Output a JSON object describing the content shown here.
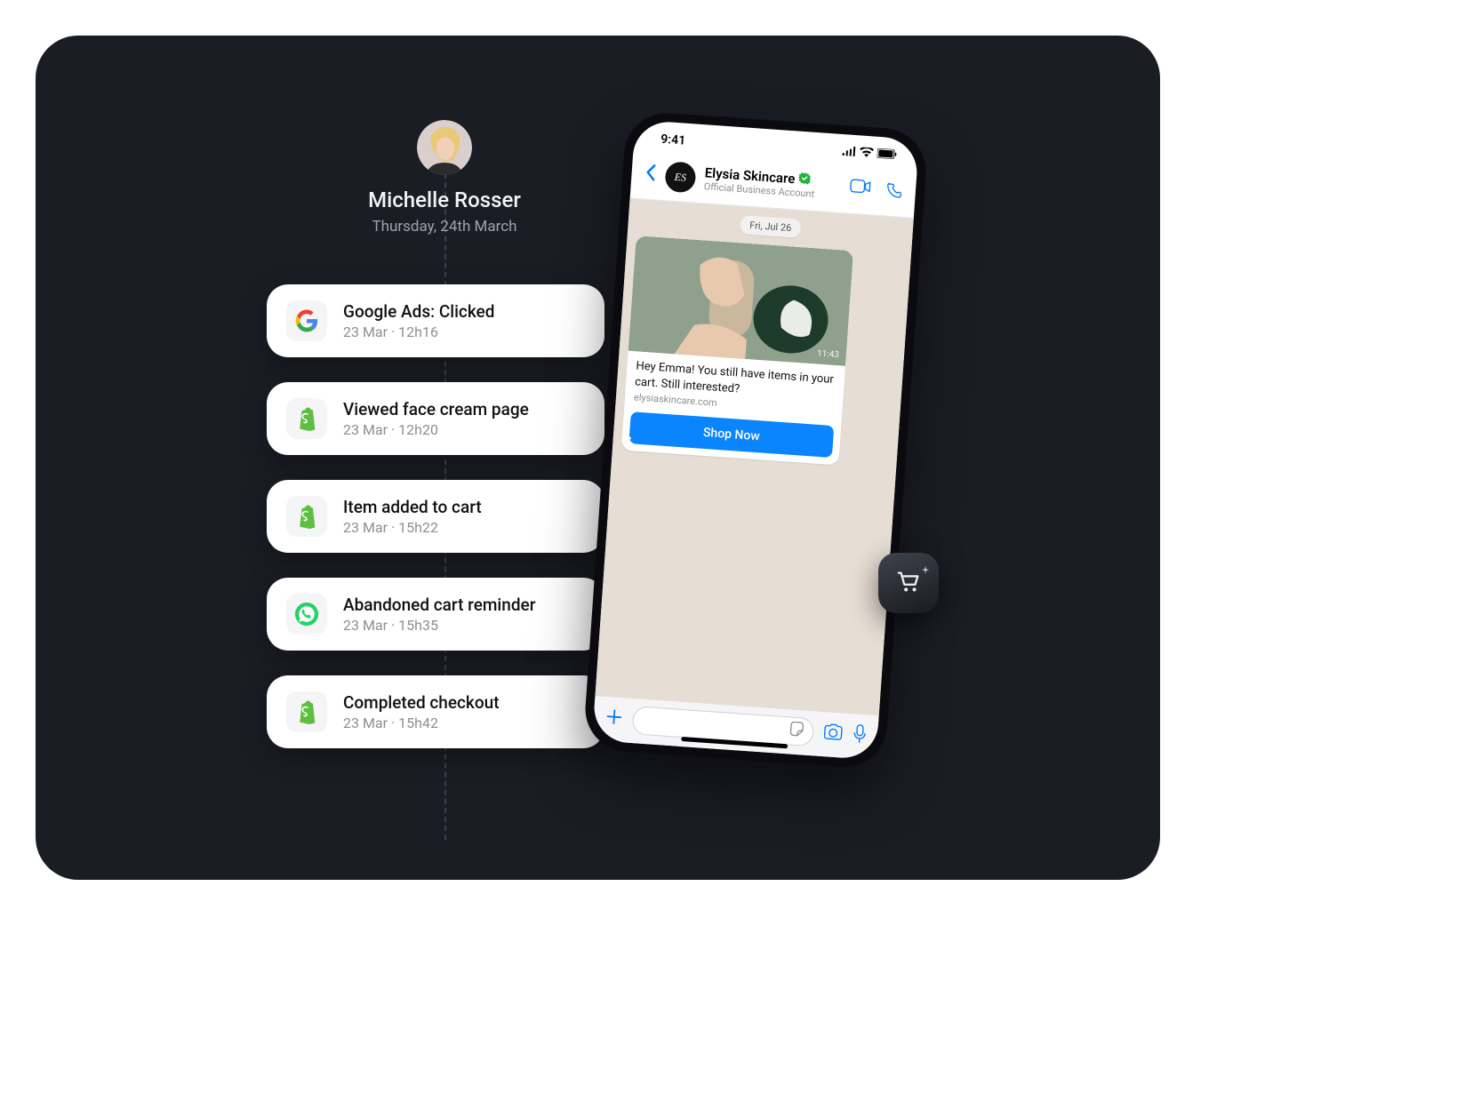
{
  "user": {
    "name": "Michelle Rosser",
    "date": "Thursday, 24th March"
  },
  "events": [
    {
      "icon": "google",
      "title": "Google Ads: Clicked",
      "time": "23 Mar · 12h16"
    },
    {
      "icon": "shopify",
      "title": "Viewed face cream page",
      "time": "23 Mar · 12h20"
    },
    {
      "icon": "shopify",
      "title": "Item added to cart",
      "time": "23 Mar · 15h22"
    },
    {
      "icon": "whatsapp",
      "title": "Abandoned cart reminder",
      "time": "23 Mar · 15h35"
    },
    {
      "icon": "shopify",
      "title": "Completed checkout",
      "time": "23 Mar · 15h42"
    }
  ],
  "phone": {
    "status_time": "9:41",
    "business_name": "Elysia Skincare",
    "business_sub": "Official Business Account",
    "business_initials": "ES",
    "chat_date": "Fri, Jul 26",
    "message_text": "Hey Emma! You still have items in your cart. Still interested?",
    "message_domain": "elysiaskincare.com",
    "message_time": "11:43",
    "cta_label": "Shop Now"
  }
}
